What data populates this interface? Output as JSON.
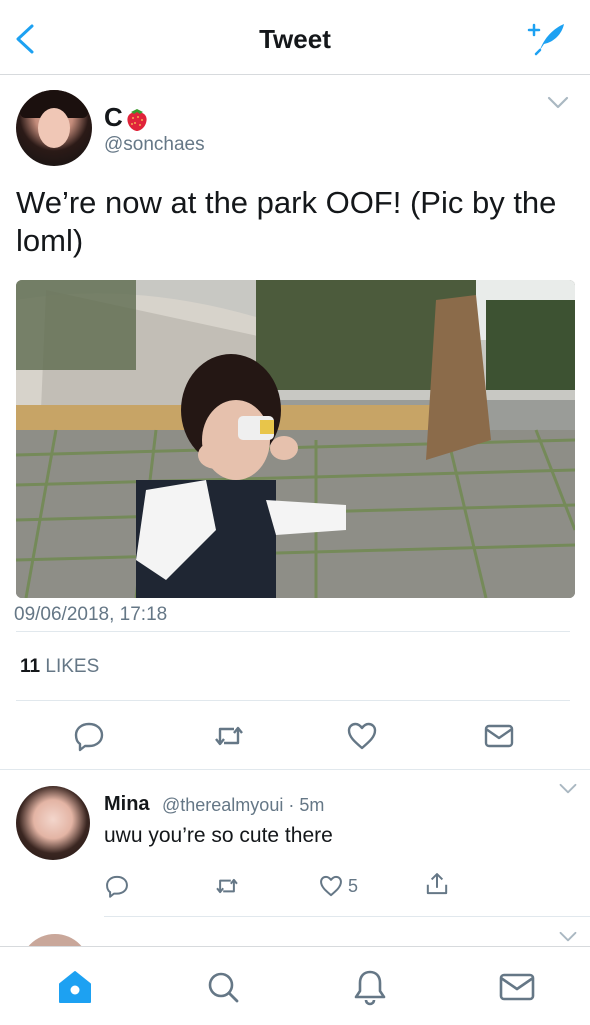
{
  "header": {
    "title": "Tweet",
    "back_icon": "chevron-left-icon",
    "compose_icon": "compose-tweet-icon",
    "accent": "#1da1f2"
  },
  "tweet": {
    "name": "C",
    "name_emoji": "strawberry",
    "handle": "@sonchaes",
    "text": "We’re now at the park OOF! (Pic by the loml)",
    "timestamp": "09/06/2018, 17:18",
    "likes_count": "11",
    "likes_label": "LIKES"
  },
  "reply": {
    "name": "Mina",
    "handle_meta": "@therealmyoui · 5m",
    "text": "uwu you’re so cute there",
    "like_count": "5"
  },
  "bottom_nav": {
    "items": [
      "home-icon",
      "search-icon",
      "notifications-icon",
      "messages-icon"
    ],
    "active_color": "#1da1f2",
    "inactive_color": "#657786"
  }
}
